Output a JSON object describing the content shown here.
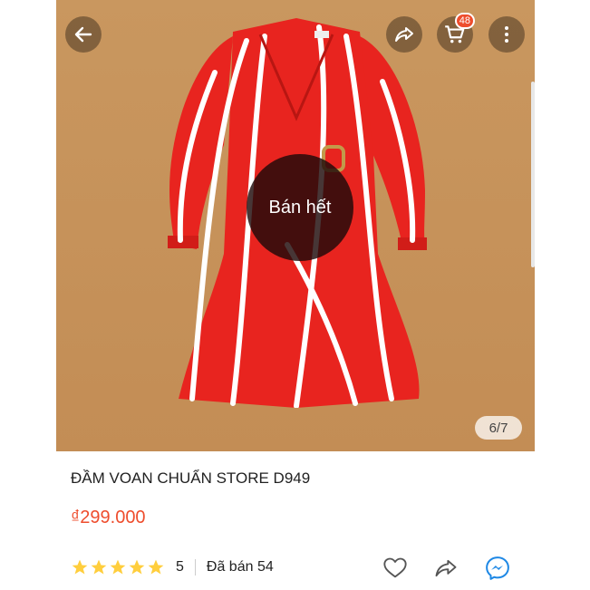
{
  "header": {
    "cart_count": "48"
  },
  "product": {
    "image_overlay": "Bán hết",
    "image_pager": "6/7",
    "title": "ĐẦM VOAN CHUẨN STORE D949",
    "price": "₫299.000",
    "rating_value": "5",
    "sold_text": "Đã bán 54"
  },
  "colors": {
    "accent": "#ee4d2d",
    "dress": "#e8241f",
    "background": "#c89560"
  },
  "icons": [
    "back-arrow-icon",
    "share-icon",
    "cart-icon",
    "more-icon",
    "star-icon",
    "heart-icon",
    "share-icon",
    "messenger-icon"
  ]
}
